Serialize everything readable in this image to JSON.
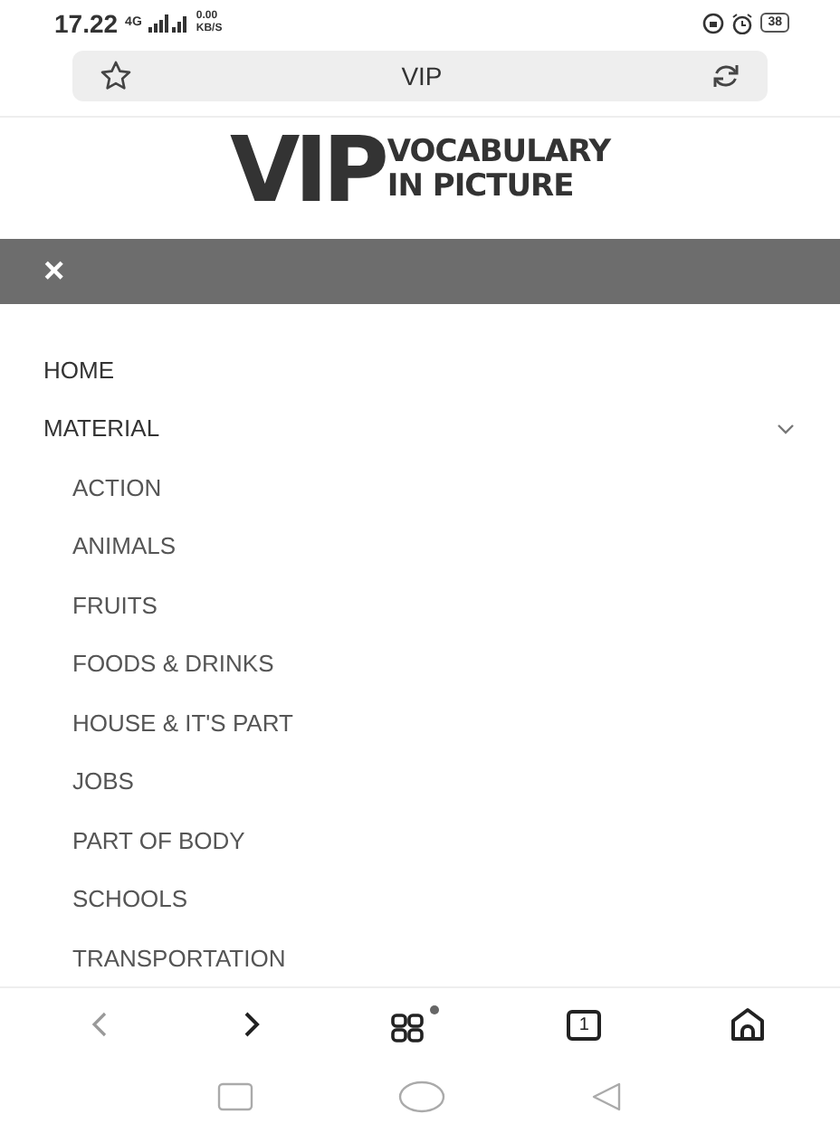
{
  "status_bar": {
    "time": "17.22",
    "network": "4G",
    "speed": "0.00 KB/S",
    "battery": "38"
  },
  "address_bar": {
    "title": "VIP"
  },
  "logo": {
    "big": "VIP",
    "line_1": "VOCABULARY",
    "line_2": "IN PICTURE"
  },
  "menu_bar": {
    "close": "×"
  },
  "menu": [
    {
      "label": "HOME"
    },
    {
      "label": "MATERIAL",
      "expanded": true,
      "children": [
        {
          "label": "ACTION"
        },
        {
          "label": "ANIMALS"
        },
        {
          "label": "FRUITS"
        },
        {
          "label": "FOODS & DRINKS"
        },
        {
          "label": "HOUSE & IT'S PART"
        },
        {
          "label": "JOBS"
        },
        {
          "label": "PART OF BODY"
        },
        {
          "label": "SCHOOLS"
        },
        {
          "label": "TRANSPORTATION"
        }
      ]
    }
  ],
  "toolbar": {
    "tab_count": "1",
    "apps_badge": true
  }
}
